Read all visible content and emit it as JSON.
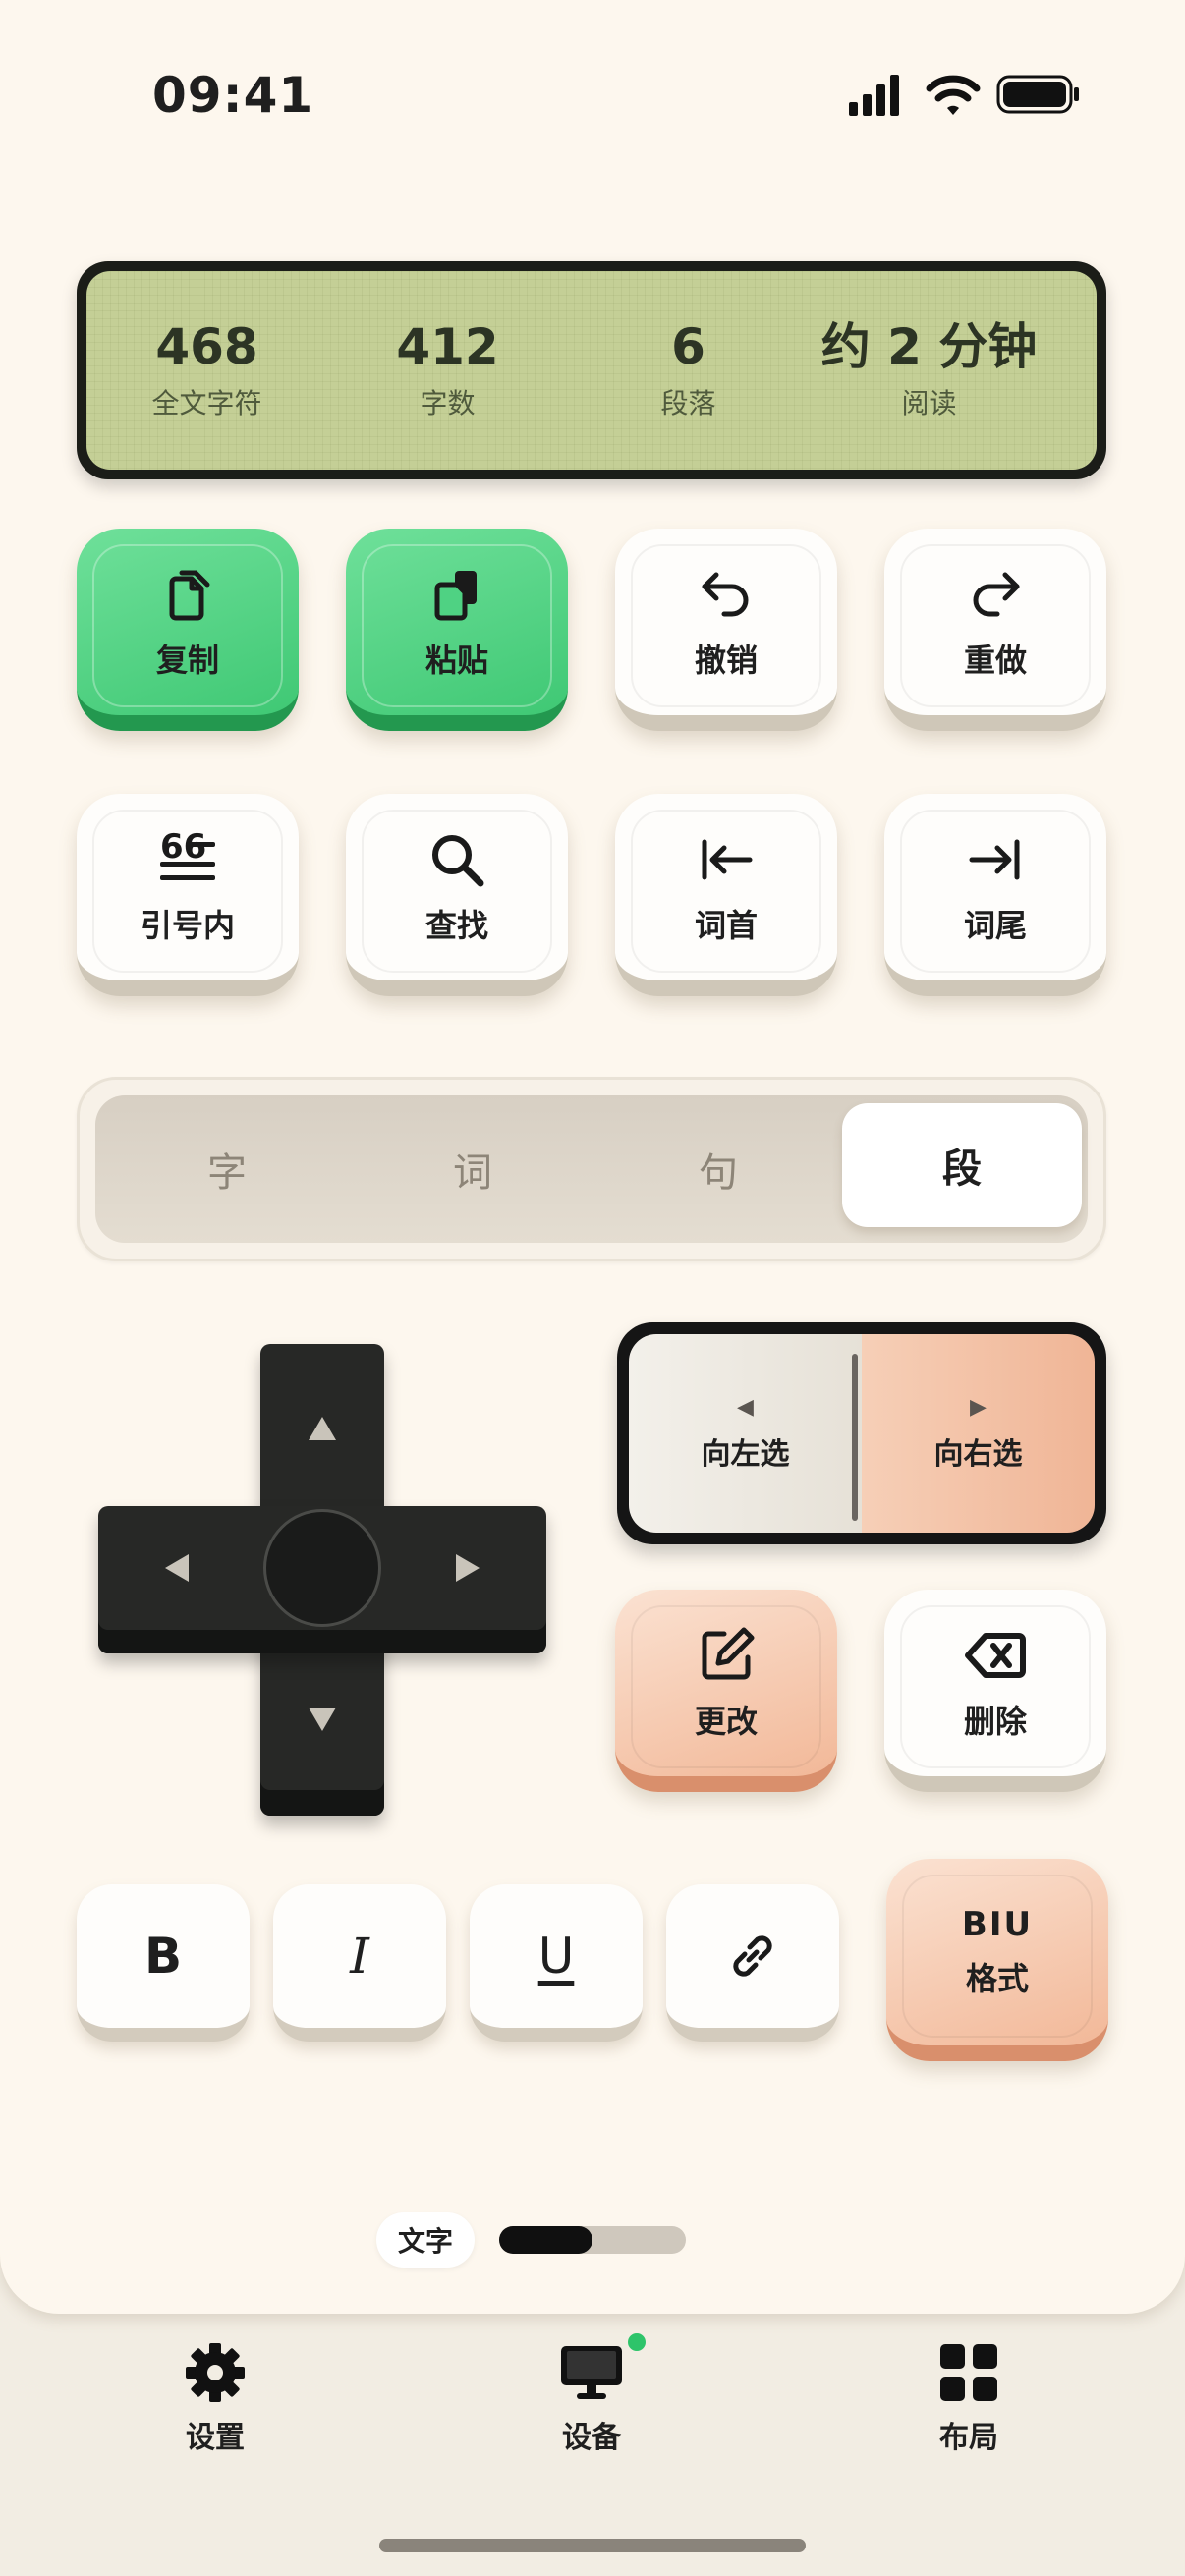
{
  "status_bar": {
    "time": "09:41"
  },
  "stats": [
    {
      "value": "468",
      "label": "全文字符"
    },
    {
      "value": "412",
      "label": "字数"
    },
    {
      "value": "6",
      "label": "段落"
    },
    {
      "value": "约 2 分钟",
      "label": "阅读"
    }
  ],
  "actions": {
    "copy": "复制",
    "paste": "粘贴",
    "undo": "撤销",
    "redo": "重做",
    "quote": "引号内",
    "find": "查找",
    "word_start": "词首",
    "word_end": "词尾"
  },
  "granularity": {
    "options": [
      "字",
      "词",
      "句",
      "段"
    ],
    "selected": "段"
  },
  "selection": {
    "left": "向左选",
    "right": "向右选"
  },
  "edit": {
    "change": "更改",
    "delete": "删除"
  },
  "format": {
    "bold": "B",
    "italic": "I",
    "underline": "U",
    "biu": "BIU",
    "label": "格式"
  },
  "page_indicator": {
    "label": "文字",
    "progress": 0.5
  },
  "tabs": [
    {
      "label": "设置"
    },
    {
      "label": "设备"
    },
    {
      "label": "布局"
    }
  ],
  "colors": {
    "accent_green": "#3fc874",
    "accent_peach": "#f2b898",
    "lcd": "#c4cf96",
    "status_dot": "#2ec46a"
  }
}
